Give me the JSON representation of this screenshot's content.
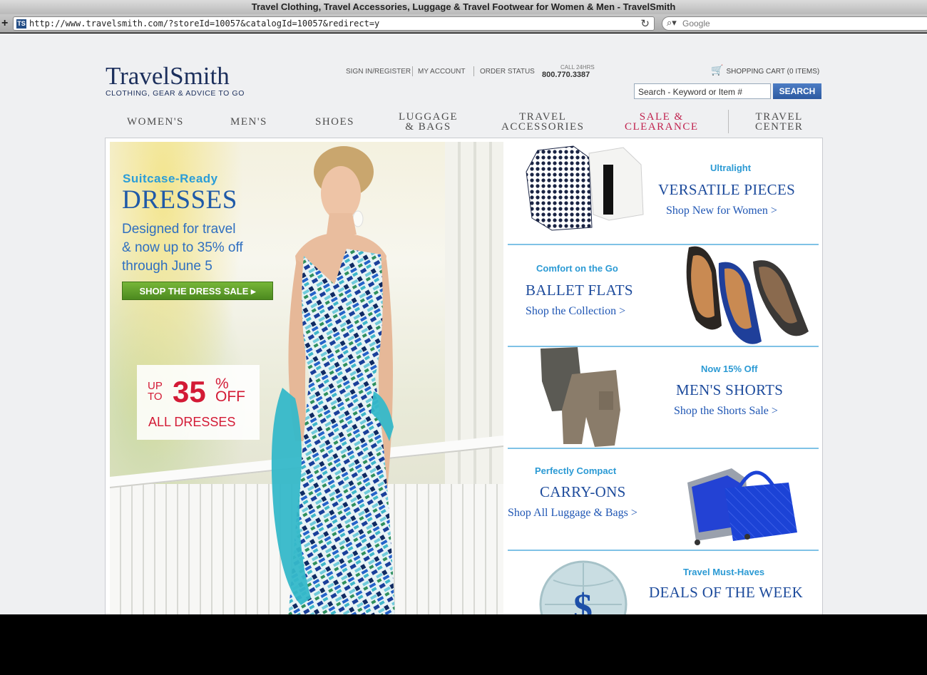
{
  "browser": {
    "window_title": "Travel Clothing, Travel Accessories, Luggage & Travel Footwear for Women & Men - TravelSmith",
    "url": "http://www.travelsmith.com/?storeId=10057&catalogId=10057&redirect=y",
    "favicon_text": "TS",
    "search_placeholder": "Google",
    "new_tab_label": "+"
  },
  "header": {
    "logo_name_a": "Travel",
    "logo_name_b": "Smith",
    "logo_tagline": "CLOTHING, GEAR & ADVICE TO GO",
    "utility_links": [
      "SIGN IN/REGISTER",
      "MY ACCOUNT",
      "ORDER STATUS"
    ],
    "call_label": "CALL 24HRS",
    "phone": "800.770.3387",
    "cart_label": "SHOPPING CART (0 ITEMS)",
    "search_placeholder": "Search - Keyword or Item #",
    "search_button": "SEARCH"
  },
  "nav": [
    {
      "label": "WOMEN'S"
    },
    {
      "label": "MEN'S"
    },
    {
      "label": "SHOES"
    },
    {
      "label": "LUGGAGE\n& BAGS"
    },
    {
      "label": "TRAVEL\nACCESSORIES"
    },
    {
      "label": "SALE &\nCLEARANCE"
    },
    {
      "label": "TRAVEL\nCENTER"
    }
  ],
  "hero": {
    "kicker": "Suitcase-Ready",
    "title": "DRESSES",
    "subtitle": "Designed for travel\n& now up to 35% off\nthrough June 5",
    "cta": "SHOP THE DRESS SALE ▸",
    "promo_upto": "UP\nTO",
    "promo_pct": "35",
    "promo_pct_sign": "%\nOFF",
    "promo_all": "ALL DRESSES"
  },
  "tiles": [
    {
      "kicker": "Ultralight",
      "title": "VERSATILE PIECES",
      "link": "Shop New for Women >"
    },
    {
      "kicker": "Comfort on the Go",
      "title": "BALLET FLATS",
      "link": "Shop the Collection >"
    },
    {
      "kicker": "Now 15% Off",
      "title": "MEN'S SHORTS",
      "link": "Shop the Shorts Sale >"
    },
    {
      "kicker": "Perfectly Compact",
      "title": "CARRY-ONS",
      "link": "Shop All Luggage & Bags >"
    },
    {
      "kicker": "Travel Must-Haves",
      "title": "DEALS OF THE WEEK",
      "link": ""
    }
  ],
  "colors": {
    "brand_navy": "#1c2f5c",
    "accent_blue": "#2b9ad4",
    "sale_red": "#c0224e",
    "cta_green": "#5a9b27"
  }
}
